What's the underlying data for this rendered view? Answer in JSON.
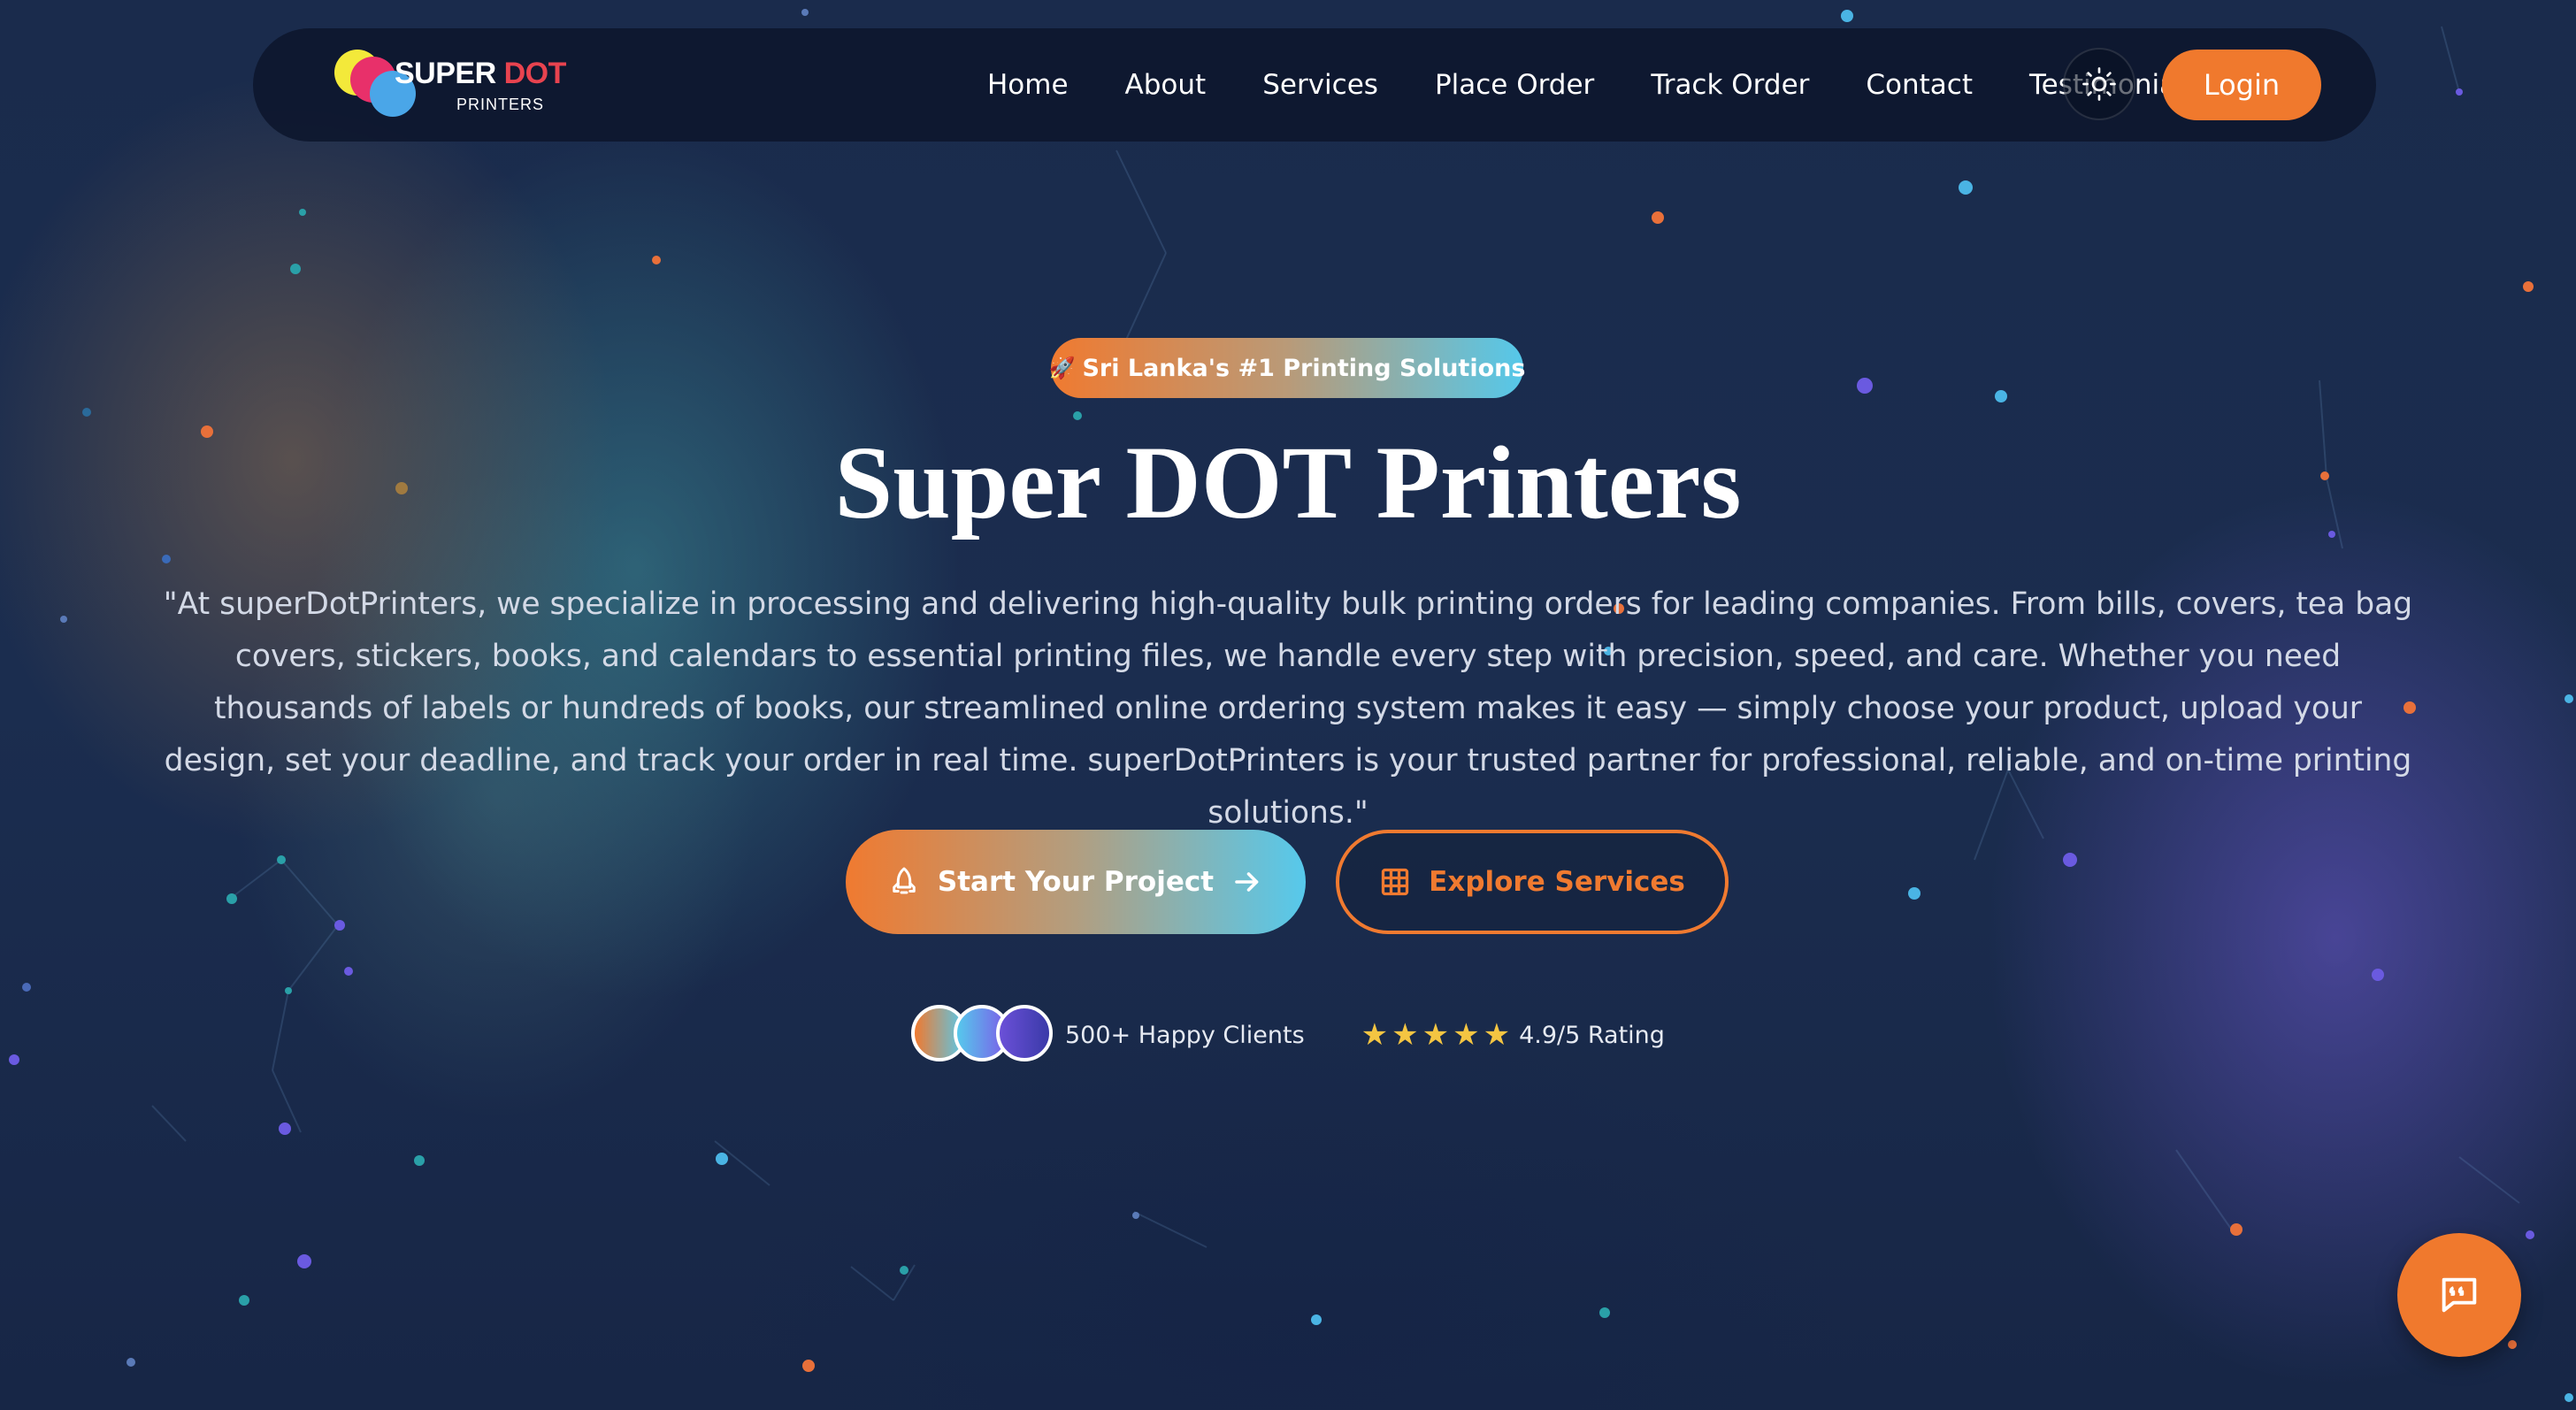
{
  "brand": {
    "name_part1": "SUPER",
    "name_part2": "DOT",
    "sub": "PRINTERS"
  },
  "nav": {
    "items": [
      {
        "label": "Home"
      },
      {
        "label": "About"
      },
      {
        "label": "Services"
      },
      {
        "label": "Place Order"
      },
      {
        "label": "Track Order"
      },
      {
        "label": "Contact"
      },
      {
        "label": "Testimonials"
      }
    ],
    "theme_icon": "sun-icon",
    "login_label": "Login"
  },
  "hero": {
    "badge": "Sri Lanka's #1 Printing Solutions",
    "badge_icon": "rocket-icon",
    "title": "Super DOT Printers",
    "description": "\"At superDotPrinters, we specialize in processing and delivering high-quality bulk printing orders for leading companies. From bills, covers, tea bag covers, stickers, books, and calendars to essential printing files, we handle every step with precision, speed, and care. Whether you need thousands of labels or hundreds of books, our streamlined online ordering system makes it easy — simply choose your product, upload your design, set your deadline, and track your order in real time. superDotPrinters is your trusted partner for professional, reliable, and on-time printing solutions.\"",
    "cta_primary": "Start Your Project",
    "cta_secondary": "Explore Services",
    "clients_text": "500+ Happy Clients",
    "stars": "★★★★★",
    "rating_text": "4.9/5 Rating"
  },
  "colors": {
    "accent": "#f0792d",
    "accent_blue": "#56c9ec",
    "background": "#1b2d4f",
    "star": "#f4c542"
  },
  "chat_icon": "chat-quote-icon"
}
